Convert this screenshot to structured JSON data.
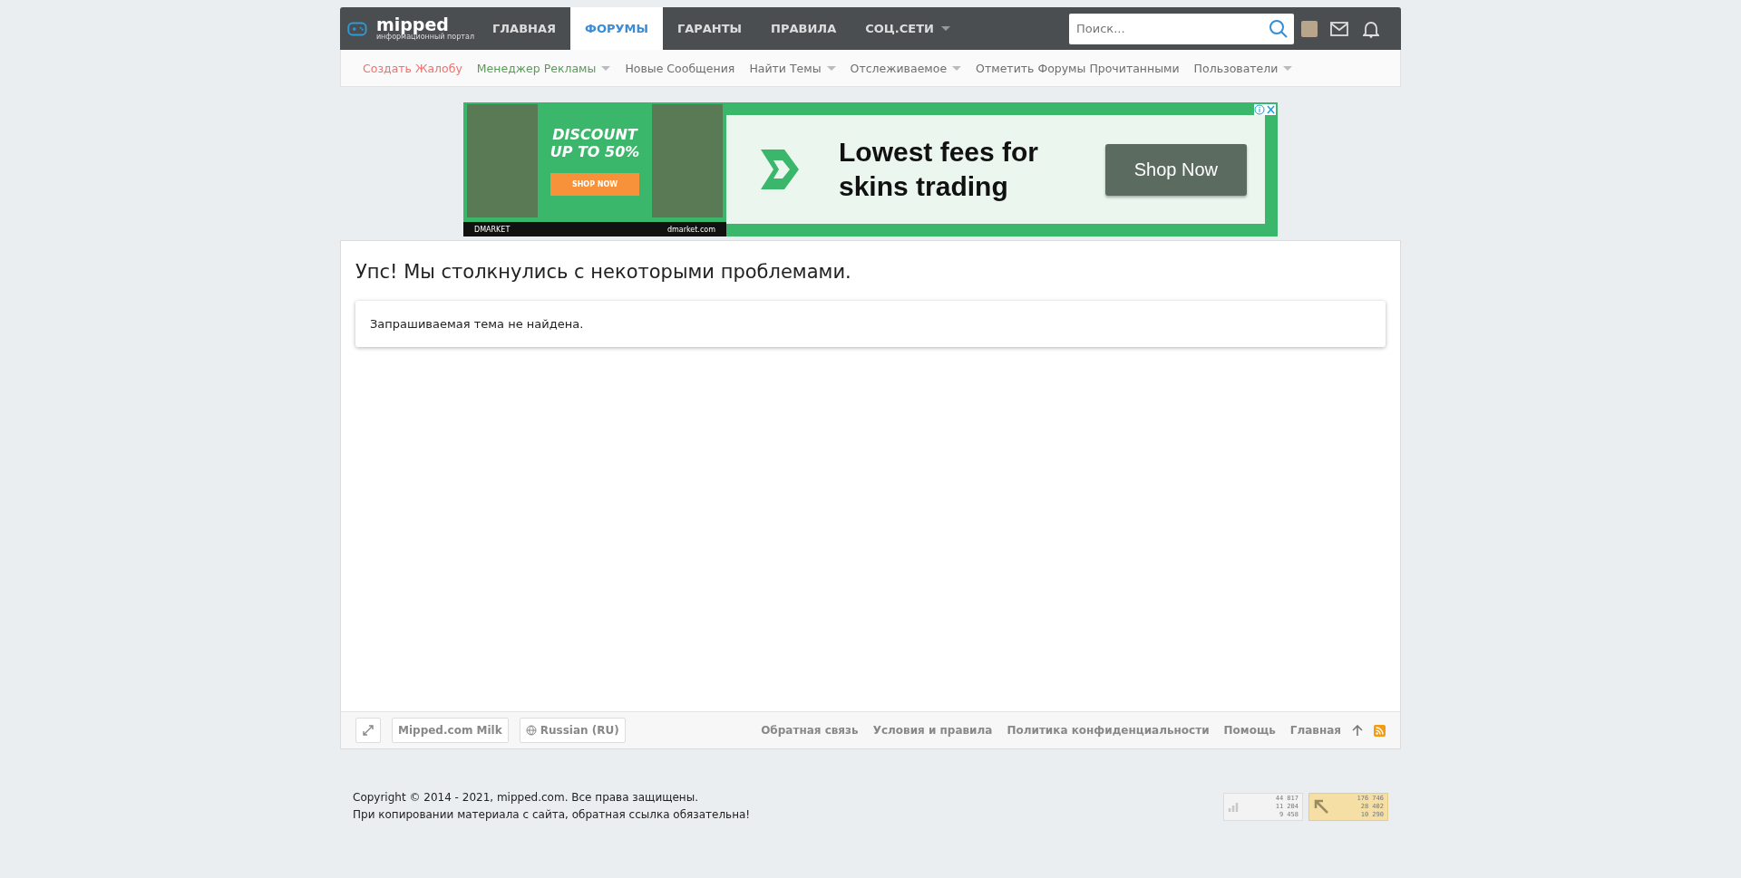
{
  "header": {
    "logo": {
      "name": "mipped",
      "tagline": "информационный портал"
    },
    "tabs": [
      {
        "label": "ГЛАВНАЯ",
        "selected": false,
        "has_menu": false
      },
      {
        "label": "ФОРУМЫ",
        "selected": true,
        "has_menu": false
      },
      {
        "label": "ГАРАНТЫ",
        "selected": false,
        "has_menu": false
      },
      {
        "label": "ПРАВИЛА",
        "selected": false,
        "has_menu": false
      },
      {
        "label": "СОЦ.СЕТИ",
        "selected": false,
        "has_menu": true
      }
    ],
    "search": {
      "placeholder": "Поиск..."
    }
  },
  "subnav": [
    {
      "label": "Создать Жалобу",
      "color": "#f0726d",
      "has_menu": false
    },
    {
      "label": "Менеджер Рекламы",
      "color": "#5b9a5b",
      "has_menu": true
    },
    {
      "label": "Новые Сообщения",
      "color": "#6e6e6e",
      "has_menu": false
    },
    {
      "label": "Найти Темы",
      "color": "#6e6e6e",
      "has_menu": true
    },
    {
      "label": "Отслеживаемое",
      "color": "#6e6e6e",
      "has_menu": true
    },
    {
      "label": "Отметить Форумы Прочитанными",
      "color": "#6e6e6e",
      "has_menu": false
    },
    {
      "label": "Пользователи",
      "color": "#6e6e6e",
      "has_menu": true
    }
  ],
  "ad": {
    "left_headline": "DISCOUNT UP TO 50%",
    "left_button": "SHOP NOW",
    "left_brand": "DMARKET",
    "left_site": "dmarket.com",
    "headline": "Lowest fees for skins trading",
    "button": "Shop Now"
  },
  "error": {
    "title": "Упс! Мы столкнулись с некоторыми проблемами.",
    "message": "Запрашиваемая тема не найдена."
  },
  "footer_bar": {
    "style_button": "Mipped.com Milk",
    "language_button": "Russian (RU)",
    "links": [
      "Обратная связь",
      "Условия и правила",
      "Политика конфиденциальности",
      "Помощь",
      "Главная"
    ]
  },
  "copyright": [
    "Copyright © 2014 - 2021, mipped.com. Все права защищены.",
    "При копировании материала с сайта, обратная ссылка обязательна!"
  ],
  "counters": [
    {
      "kind": "views",
      "lines": [
        "44 817",
        "11 204",
        "9 458"
      ]
    },
    {
      "kind": "hits",
      "lines": [
        "176 746",
        "28 402",
        "10 290"
      ]
    }
  ]
}
